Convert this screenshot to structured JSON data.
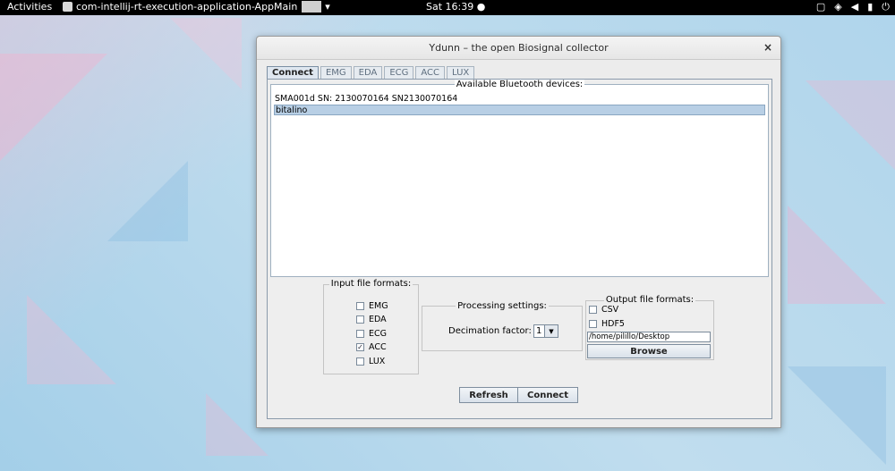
{
  "topbar": {
    "activities": "Activities",
    "app_name": "com-intellij-rt-execution-application-AppMain",
    "clock": "Sat 16:39",
    "icons": [
      "screen-icon",
      "network-icon",
      "volume-icon",
      "battery-icon",
      "power-icon"
    ]
  },
  "window": {
    "title": "Ydunn – the open Biosignal collector",
    "close_glyph": "×"
  },
  "tabs": [
    {
      "label": "Connect",
      "active": true
    },
    {
      "label": "EMG",
      "active": false
    },
    {
      "label": "EDA",
      "active": false
    },
    {
      "label": "ECG",
      "active": false
    },
    {
      "label": "ACC",
      "active": false
    },
    {
      "label": "LUX",
      "active": false
    }
  ],
  "devices": {
    "legend": "Available Bluetooth devices:",
    "items": [
      {
        "label": "SMA001d SN: 2130070164 SN2130070164",
        "selected": false
      },
      {
        "label": "bitalino",
        "selected": true
      }
    ]
  },
  "input_formats": {
    "legend": "Input file formats:",
    "options": [
      {
        "label": "EMG",
        "checked": false
      },
      {
        "label": "EDA",
        "checked": false
      },
      {
        "label": "ECG",
        "checked": false
      },
      {
        "label": "ACC",
        "checked": true
      },
      {
        "label": "LUX",
        "checked": false
      }
    ]
  },
  "processing": {
    "legend": "Processing settings:",
    "decimation_label": "Decimation factor:",
    "decimation_value": "1"
  },
  "output_formats": {
    "legend": "Output file formats:",
    "options": [
      {
        "label": "CSV",
        "checked": false
      },
      {
        "label": "HDF5",
        "checked": false
      }
    ],
    "path": "/home/pilillo/Desktop",
    "browse_label": "Browse"
  },
  "actions": {
    "refresh_label": "Refresh",
    "connect_label": "Connect"
  },
  "colors": {
    "selection": "#b8cfe5",
    "topbar": "#000000",
    "window_bg": "#ececec"
  }
}
